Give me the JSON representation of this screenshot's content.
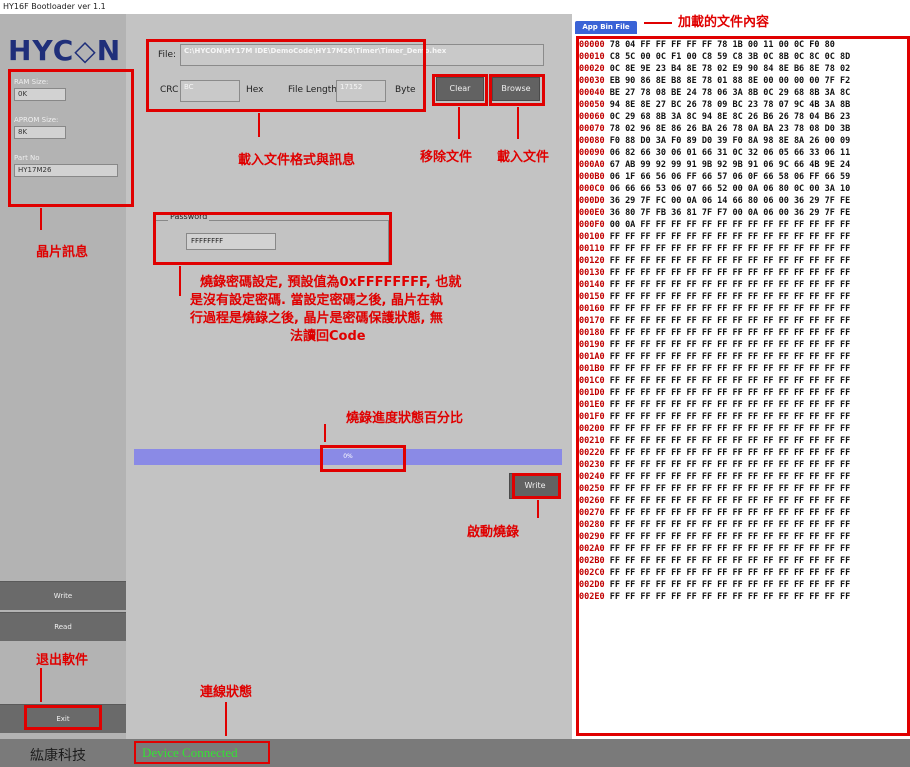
{
  "window": {
    "title": "HY16F Bootloader ver 1.1"
  },
  "sidebar": {
    "logo": "HYC◇N",
    "ram_label": "RAM Size:",
    "ram_value": "0K",
    "aprom_label": "APROM Size:",
    "aprom_value": "8K",
    "part_label": "Part No",
    "part_value": "HY17M26",
    "write_label": "Write",
    "read_label": "Read",
    "exit_label": "Exit"
  },
  "main": {
    "file_label": "File:",
    "file_value": "C:\\HYCON\\HY17M IDE\\DemoCode\\HY17M26\\Timer\\Timer_Demo.hex",
    "crc_label": "CRC",
    "crc_value": "BC",
    "hex_label": "Hex",
    "length_label": "File Length:",
    "length_value": "17152",
    "byte_label": "Byte",
    "clear_label": "Clear",
    "browse_label": "Browse",
    "password_group": "Password",
    "password_value": "FFFFFFFF",
    "progress_text": "0%",
    "progress_fraction": 0,
    "write_label": "Write"
  },
  "footer": {
    "company": "紘康科技",
    "status": "Device Connected"
  },
  "hex": {
    "tab_label": "App Bin File",
    "rows": [
      {
        "addr": "00000",
        "bytes": "78 04 FF FF FF FF FF 78 1B 00 11 00 0C F0 80"
      },
      {
        "addr": "00010",
        "bytes": "C8 5C 00 0C F1 00 C8 59 C8 3B 0C 8B 0C 8C 0C 8D"
      },
      {
        "addr": "00020",
        "bytes": "0C 8E 9E 23 B4 8E 78 02 E9 90 84 8E B6 8E 78 02"
      },
      {
        "addr": "00030",
        "bytes": "EB 90 86 8E B8 8E 78 01 88 8E 00 00 00 00 7F F2"
      },
      {
        "addr": "00040",
        "bytes": "BE 27 78 08 BE 24 78 06 3A 8B 0C 29 68 8B 3A 8C"
      },
      {
        "addr": "00050",
        "bytes": "94 8E 8E 27 BC 26 78 09 BC 23 78 07 9C 4B 3A 8B"
      },
      {
        "addr": "00060",
        "bytes": "0C 29 68 8B 3A 8C 94 8E 8C 26 B6 26 78 04 B6 23"
      },
      {
        "addr": "00070",
        "bytes": "78 02 96 8E 86 26 BA 26 78 0A BA 23 78 08 D0 3B"
      },
      {
        "addr": "00080",
        "bytes": "F0 88 D0 3A F0 89 D0 39 F0 8A 98 8E 8A 26 00 09"
      },
      {
        "addr": "00090",
        "bytes": "06 82 66 30 06 01 66 31 0C 32 06 05 66 33 06 11"
      },
      {
        "addr": "000A0",
        "bytes": "67 AB 99 92 99 91 9B 92 9B 91 06 9C 66 4B 9E 24"
      },
      {
        "addr": "000B0",
        "bytes": "06 1F 66 56 06 FF 66 57 06 0F 66 58 06 FF 66 59"
      },
      {
        "addr": "000C0",
        "bytes": "06 66 66 53 06 07 66 52 00 0A 06 80 0C 00 3A 10"
      },
      {
        "addr": "000D0",
        "bytes": "36 29 7F FC 00 0A 06 14 66 80 06 00 36 29 7F FE"
      },
      {
        "addr": "000E0",
        "bytes": "36 80 7F FB 36 81 7F F7 00 0A 06 00 36 29 7F FE"
      },
      {
        "addr": "000F0",
        "bytes": "00 0A FF FF FF FF FF FF FF FF FF FF FF FF FF FF"
      },
      {
        "addr": "00100",
        "bytes": "FF FF FF FF FF FF FF FF FF FF FF FF FF FF FF FF"
      },
      {
        "addr": "00110",
        "bytes": "FF FF FF FF FF FF FF FF FF FF FF FF FF FF FF FF"
      },
      {
        "addr": "00120",
        "bytes": "FF FF FF FF FF FF FF FF FF FF FF FF FF FF FF FF"
      },
      {
        "addr": "00130",
        "bytes": "FF FF FF FF FF FF FF FF FF FF FF FF FF FF FF FF"
      },
      {
        "addr": "00140",
        "bytes": "FF FF FF FF FF FF FF FF FF FF FF FF FF FF FF FF"
      },
      {
        "addr": "00150",
        "bytes": "FF FF FF FF FF FF FF FF FF FF FF FF FF FF FF FF"
      },
      {
        "addr": "00160",
        "bytes": "FF FF FF FF FF FF FF FF FF FF FF FF FF FF FF FF"
      },
      {
        "addr": "00170",
        "bytes": "FF FF FF FF FF FF FF FF FF FF FF FF FF FF FF FF"
      },
      {
        "addr": "00180",
        "bytes": "FF FF FF FF FF FF FF FF FF FF FF FF FF FF FF FF"
      },
      {
        "addr": "00190",
        "bytes": "FF FF FF FF FF FF FF FF FF FF FF FF FF FF FF FF"
      },
      {
        "addr": "001A0",
        "bytes": "FF FF FF FF FF FF FF FF FF FF FF FF FF FF FF FF"
      },
      {
        "addr": "001B0",
        "bytes": "FF FF FF FF FF FF FF FF FF FF FF FF FF FF FF FF"
      },
      {
        "addr": "001C0",
        "bytes": "FF FF FF FF FF FF FF FF FF FF FF FF FF FF FF FF"
      },
      {
        "addr": "001D0",
        "bytes": "FF FF FF FF FF FF FF FF FF FF FF FF FF FF FF FF"
      },
      {
        "addr": "001E0",
        "bytes": "FF FF FF FF FF FF FF FF FF FF FF FF FF FF FF FF"
      },
      {
        "addr": "001F0",
        "bytes": "FF FF FF FF FF FF FF FF FF FF FF FF FF FF FF FF"
      },
      {
        "addr": "00200",
        "bytes": "FF FF FF FF FF FF FF FF FF FF FF FF FF FF FF FF"
      },
      {
        "addr": "00210",
        "bytes": "FF FF FF FF FF FF FF FF FF FF FF FF FF FF FF FF"
      },
      {
        "addr": "00220",
        "bytes": "FF FF FF FF FF FF FF FF FF FF FF FF FF FF FF FF"
      },
      {
        "addr": "00230",
        "bytes": "FF FF FF FF FF FF FF FF FF FF FF FF FF FF FF FF"
      },
      {
        "addr": "00240",
        "bytes": "FF FF FF FF FF FF FF FF FF FF FF FF FF FF FF FF"
      },
      {
        "addr": "00250",
        "bytes": "FF FF FF FF FF FF FF FF FF FF FF FF FF FF FF FF"
      },
      {
        "addr": "00260",
        "bytes": "FF FF FF FF FF FF FF FF FF FF FF FF FF FF FF FF"
      },
      {
        "addr": "00270",
        "bytes": "FF FF FF FF FF FF FF FF FF FF FF FF FF FF FF FF"
      },
      {
        "addr": "00280",
        "bytes": "FF FF FF FF FF FF FF FF FF FF FF FF FF FF FF FF"
      },
      {
        "addr": "00290",
        "bytes": "FF FF FF FF FF FF FF FF FF FF FF FF FF FF FF FF"
      },
      {
        "addr": "002A0",
        "bytes": "FF FF FF FF FF FF FF FF FF FF FF FF FF FF FF FF"
      },
      {
        "addr": "002B0",
        "bytes": "FF FF FF FF FF FF FF FF FF FF FF FF FF FF FF FF"
      },
      {
        "addr": "002C0",
        "bytes": "FF FF FF FF FF FF FF FF FF FF FF FF FF FF FF FF"
      },
      {
        "addr": "002D0",
        "bytes": "FF FF FF FF FF FF FF FF FF FF FF FF FF FF FF FF"
      },
      {
        "addr": "002E0",
        "bytes": "FF FF FF FF FF FF FF FF FF FF FF FF FF FF FF FF"
      }
    ]
  },
  "annotations": {
    "hex_content": "加載的文件內容",
    "file_info": "載入文件格式與訊息",
    "remove_file": "移除文件",
    "load_file": "載入文件",
    "chip_info": "晶片訊息",
    "password_note_1": "燒錄密碼設定, 預設值為0xFFFFFFFF, 也就",
    "password_note_2": "是沒有設定密碼. 當設定密碼之後, 晶片在執",
    "password_note_3": "行過程是燒錄之後, 晶片是密碼保護狀態, 無",
    "password_note_4": "法讀回Code",
    "progress_note": "燒錄進度狀態百分比",
    "start_burn": "啟動燒錄",
    "exit_software": "退出軟件",
    "connection_status": "連線狀態",
    "color": "#e00000"
  }
}
